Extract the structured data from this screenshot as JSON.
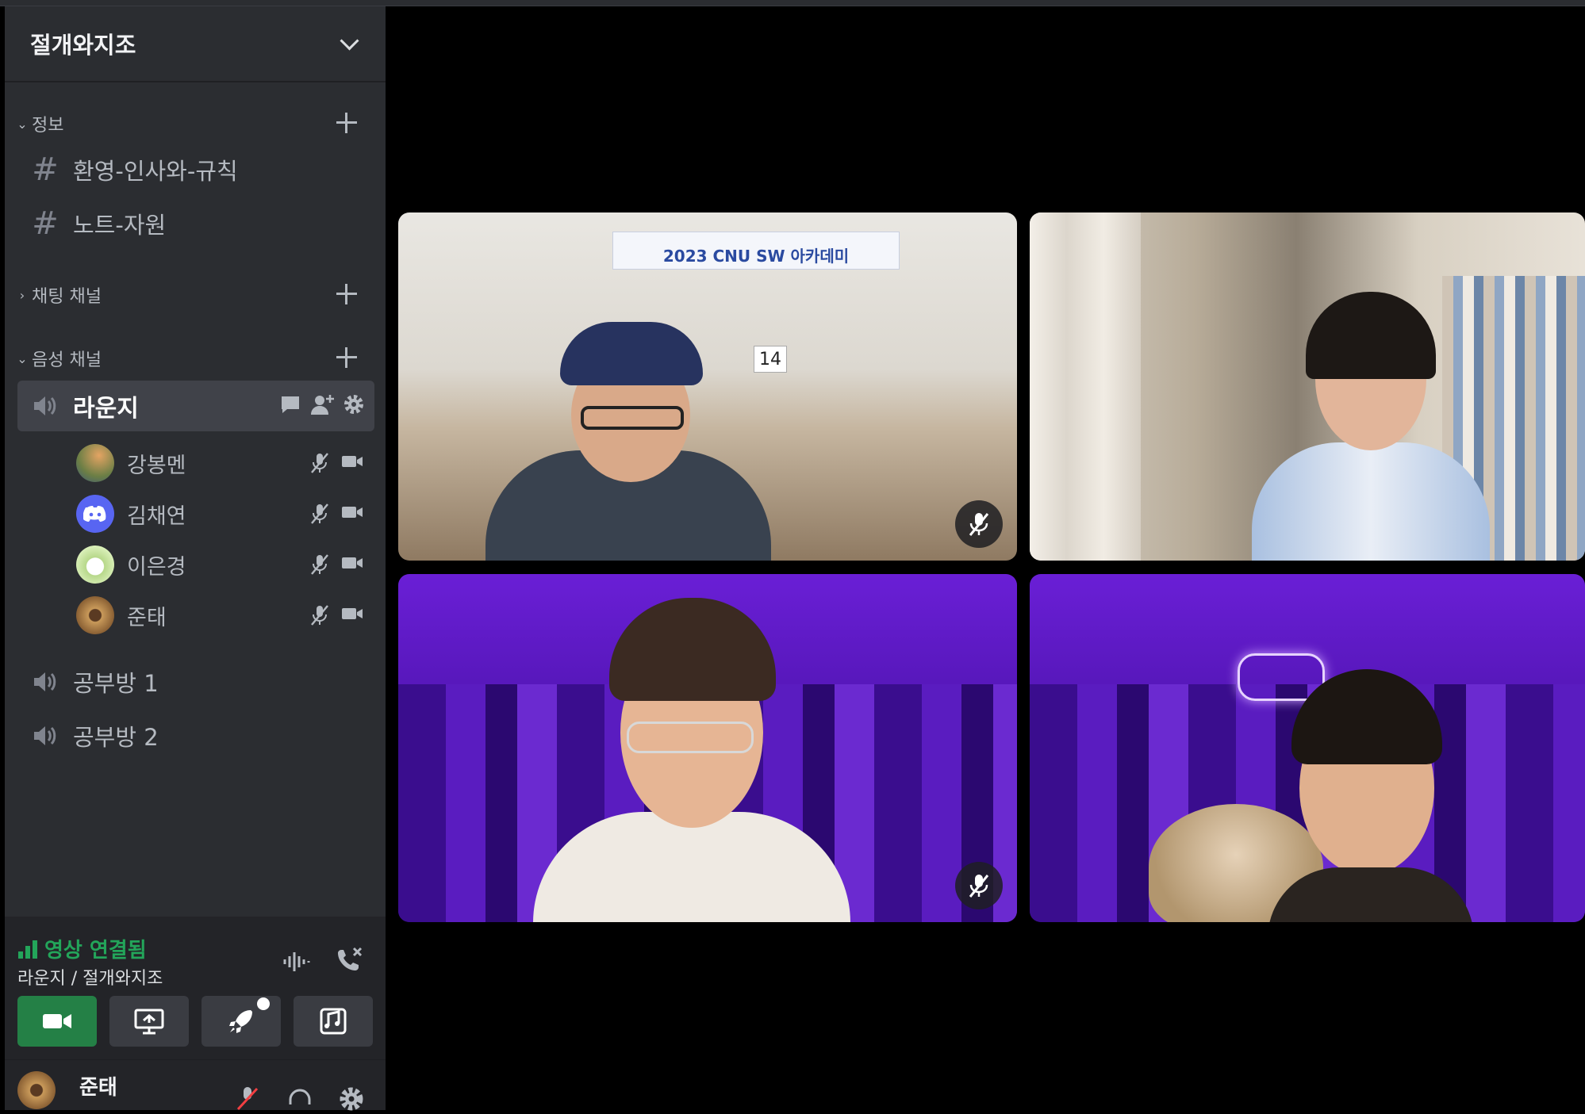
{
  "server": {
    "name": "절개와지조"
  },
  "categories": {
    "info": {
      "label": "정보"
    },
    "chat": {
      "label": "채팅 채널"
    },
    "voice": {
      "label": "음성 채널"
    }
  },
  "text_channels": [
    {
      "name": "환영-인사와-규칙"
    },
    {
      "name": "노트-자원"
    }
  ],
  "voice_channels": {
    "active": {
      "name": "라운지"
    },
    "members": [
      {
        "name": "강봉멘"
      },
      {
        "name": "김채연"
      },
      {
        "name": "이은경"
      },
      {
        "name": "준태"
      }
    ],
    "others": [
      {
        "name": "공부방 1"
      },
      {
        "name": "공부방 2"
      }
    ]
  },
  "voice_panel": {
    "status": "영상 연결됨",
    "location": "라운지 / 절개와지조"
  },
  "user": {
    "name": "준태"
  },
  "video_tiles": [
    {
      "banner_title": "2023 CNU SW 아카데미",
      "desk_number": "14",
      "muted": true
    },
    {
      "muted": false
    },
    {
      "muted": true
    },
    {
      "muted": false
    }
  ],
  "colors": {
    "sidebar": "#2b2d31",
    "panel": "#232428",
    "accent_green": "#23a55a",
    "video_purple": "#5a18c8"
  }
}
